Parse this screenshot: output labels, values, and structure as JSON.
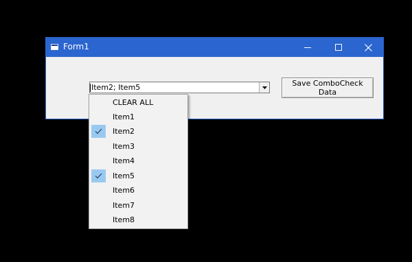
{
  "window": {
    "title": "Form1"
  },
  "combo": {
    "value": "Item2; Item5"
  },
  "save_button": {
    "label": "Save ComboCheck Data"
  },
  "dropdown": {
    "items": [
      {
        "label": "CLEAR ALL",
        "checked": false
      },
      {
        "label": "Item1",
        "checked": false
      },
      {
        "label": "Item2",
        "checked": true
      },
      {
        "label": "Item3",
        "checked": false
      },
      {
        "label": "Item4",
        "checked": false
      },
      {
        "label": "Item5",
        "checked": true
      },
      {
        "label": "Item6",
        "checked": false
      },
      {
        "label": "Item7",
        "checked": false
      },
      {
        "label": "Item8",
        "checked": false
      }
    ]
  },
  "colors": {
    "titlebar": "#2b65cf",
    "check_highlight": "#9ac9f0",
    "desktop": "#000000"
  }
}
